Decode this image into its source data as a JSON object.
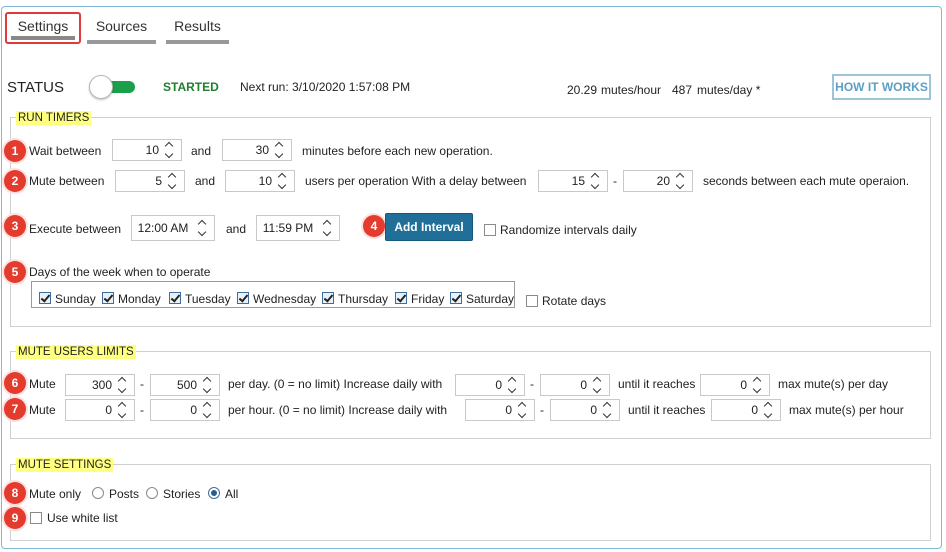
{
  "tabs": [
    {
      "label": "Settings",
      "active": true
    },
    {
      "label": "Sources",
      "active": false
    },
    {
      "label": "Results",
      "active": false
    }
  ],
  "status": {
    "label": "STATUS",
    "toggle_on": true,
    "state": "STARTED",
    "next_run": "Next run: 3/10/2020 1:57:08 PM",
    "rate_hour_value": "20.29",
    "rate_hour_unit": "mutes/hour",
    "rate_day_value": "487",
    "rate_day_unit": "mutes/day *",
    "how_it_works": "HOW IT WORKS"
  },
  "run_timers": {
    "title": "RUN TIMERS",
    "wait": {
      "badge": "1",
      "label": "Wait between",
      "min": "10",
      "and": "and",
      "max": "30",
      "suffix": "minutes before each new operation."
    },
    "mute": {
      "badge": "2",
      "label": "Mute between",
      "min": "5",
      "and": "and",
      "max": "10",
      "mid": "users per operation  With a delay between",
      "delay_min": "15",
      "dash": "-",
      "delay_max": "20",
      "suffix": "seconds between each mute operaion."
    },
    "execute": {
      "badge": "3",
      "label": "Execute between",
      "start": "12:00 AM",
      "and": "and",
      "end": "11:59 PM",
      "add_badge": "4",
      "add_label": "Add Interval",
      "randomize_label": "Randomize intervals daily",
      "randomize_checked": false
    },
    "days": {
      "badge": "5",
      "label": "Days of the week when to operate",
      "items": [
        {
          "label": "Sunday",
          "checked": true
        },
        {
          "label": "Monday",
          "checked": true
        },
        {
          "label": "Tuesday",
          "checked": true
        },
        {
          "label": "Wednesday",
          "checked": true
        },
        {
          "label": "Thursday",
          "checked": true
        },
        {
          "label": "Friday",
          "checked": true
        },
        {
          "label": "Saturday",
          "checked": true
        }
      ],
      "rotate_label": "Rotate days",
      "rotate_checked": false
    }
  },
  "limits": {
    "title": "MUTE USERS LIMITS",
    "per_day": {
      "badge": "6",
      "label": "Mute",
      "min": "300",
      "dash": "-",
      "max": "500",
      "mid": "per day. (0 = no limit)  Increase daily with",
      "inc_min": "0",
      "dash2": "-",
      "inc_max": "0",
      "until": "until it reaches",
      "cap": "0",
      "suffix": "max mute(s) per day"
    },
    "per_hour": {
      "badge": "7",
      "label": "Mute",
      "min": "0",
      "dash": "-",
      "max": "0",
      "mid": "per hour. (0 = no limit)  Increase daily with",
      "inc_min": "0",
      "dash2": "-",
      "inc_max": "0",
      "until": "until it reaches",
      "cap": "0",
      "suffix": "max mute(s) per hour"
    }
  },
  "mute_settings": {
    "title": "MUTE SETTINGS",
    "mute_only": {
      "badge": "8",
      "label": "Mute only",
      "options": [
        {
          "label": "Posts",
          "selected": false
        },
        {
          "label": "Stories",
          "selected": false
        },
        {
          "label": "All",
          "selected": true
        }
      ]
    },
    "white_list": {
      "badge": "9",
      "label": "Use white list",
      "checked": false
    }
  },
  "colors": {
    "accent_blue": "#1f6f98",
    "started_green": "#1f7f2f",
    "badge_red": "#e33b2e",
    "legend_yellow": "#ffff80"
  }
}
